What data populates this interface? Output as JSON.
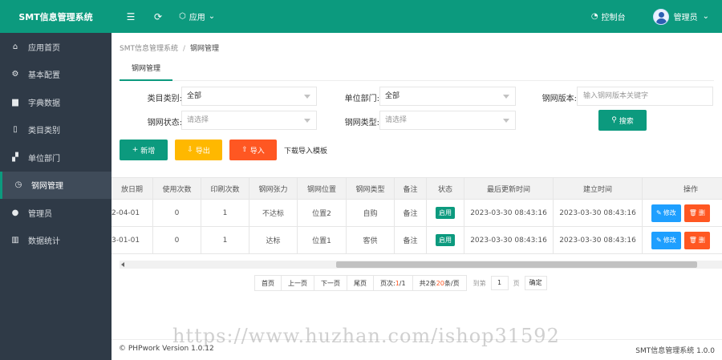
{
  "app": {
    "title": "SMT信息管理系统"
  },
  "topbar": {
    "menu_label": "应用",
    "console_label": "控制台",
    "user_label": "管理员"
  },
  "sidebar": {
    "items": [
      {
        "label": "应用首页",
        "icon": "home-icon"
      },
      {
        "label": "基本配置",
        "icon": "gear-icon"
      },
      {
        "label": "字典数据",
        "icon": "book-icon"
      },
      {
        "label": "类目类别",
        "icon": "file-icon"
      },
      {
        "label": "单位部门",
        "icon": "org-icon"
      },
      {
        "label": "钢网管理",
        "icon": "clock-icon",
        "active": true
      },
      {
        "label": "管理员",
        "icon": "user-icon"
      },
      {
        "label": "数据统计",
        "icon": "chart-icon"
      }
    ]
  },
  "breadcrumb": {
    "root": "SMT信息管理系统",
    "sep": "/",
    "current": "钢网管理"
  },
  "tab": {
    "label": "钢网管理"
  },
  "filters": {
    "category": {
      "label": "类目类别:",
      "value": "全部"
    },
    "department": {
      "label": "单位部门:",
      "value": "全部"
    },
    "version": {
      "label": "钢网版本:",
      "placeholder": "输入钢网版本关键字"
    },
    "status": {
      "label": "钢网状态:",
      "value": "请选择"
    },
    "type": {
      "label": "钢网类型:",
      "value": "请选择"
    },
    "search_label": "搜索"
  },
  "actions": {
    "add_label": "新增",
    "export_label": "导出",
    "import_label": "导入",
    "download_label": "下载导入模板"
  },
  "table": {
    "headers": [
      "放日期",
      "使用次数",
      "印刷次数",
      "钢网张力",
      "钢网位置",
      "钢网类型",
      "备注",
      "状态",
      "最后更新时间",
      "建立时间",
      "操作"
    ],
    "rows": [
      [
        "2-04-01",
        "0",
        "1",
        "不达标",
        "位置2",
        "自购",
        "备注",
        "启用",
        "2023-03-30 08:43:16",
        "2023-03-30 08:43:16"
      ],
      [
        "3-01-01",
        "0",
        "1",
        "达标",
        "位置1",
        "客供",
        "备注",
        "启用",
        "2023-03-30 08:43:16",
        "2023-03-30 08:43:16"
      ]
    ],
    "edit_label": "修改",
    "delete_label": "删"
  },
  "pager": {
    "first": "首页",
    "prev": "上一页",
    "next": "下一页",
    "last": "尾页",
    "page_prefix": "页次:",
    "page_current": "1",
    "page_total": "/1",
    "total_prefix": "共2条 ",
    "per_page": "20",
    "per_page_suffix": "条/页",
    "goto_prefix": "到第",
    "goto_value": "1",
    "goto_suffix": "页",
    "goto_button": "确定"
  },
  "footer": {
    "left": "© PHPwork Version 1.0.12",
    "right": "SMT信息管理系统 1.0.0"
  },
  "watermark": "https://www.huzhan.com/ishop31592",
  "colors": {
    "primary": "#0c9a7e",
    "sidebar": "#2f3a47",
    "warning": "#ffb800",
    "danger": "#ff5722",
    "info": "#1e9fff"
  }
}
